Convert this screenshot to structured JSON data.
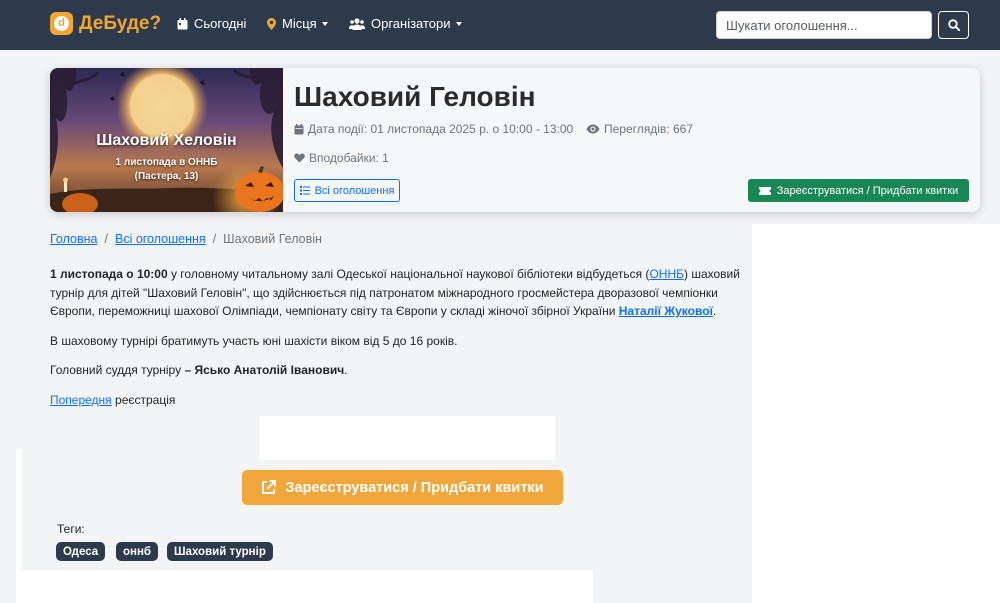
{
  "navbar": {
    "brand": "ДеБуде?",
    "brand_logo_letter": "d",
    "items": [
      {
        "label": "Сьогодні",
        "icon": "calendar-icon"
      },
      {
        "label": "Місця",
        "icon": "map-marker-icon"
      },
      {
        "label": "Організатори",
        "icon": "users-icon"
      }
    ],
    "search_placeholder": "Шукати оголошення..."
  },
  "event": {
    "title": "Шаховий Геловін",
    "poster": {
      "title": "Шаховий Хеловін",
      "line1": "1 листопада в ОННБ",
      "line2": "(Пастера, 13)"
    },
    "date": "Дата події: 01 листопада 2025 р. о 10:00 - 13:00",
    "views": "Переглядів: 667",
    "likes": "Вподобайки: 1",
    "all_label": "Всі оголошення",
    "register_label": "Зареєструватися / Придбати квитки"
  },
  "breadcrumb": {
    "home": "Головна",
    "all": "Всі оголошення",
    "current": "Шаховий Геловін"
  },
  "content": {
    "p1_bold": "1 листопада о 10:00",
    "p1_a": " у головному читальному залі Одеської національної наукової бібліотеки відбудеться (",
    "p1_link1": "ОННБ",
    "p1_b": ") шаховий",
    "p1_line2": "турнір для дітей \"Шаховий Геловін\", що здійснюється під патронатом міжнародного гросмейстера  дворазової чемпіонки",
    "p1_line3": "Європи, переможниці шахової Олімпіади, чемпіонату світу та Європи у складі жіночої збірної України ",
    "p1_link2": "Наталії Жукової",
    "p1_end": ".",
    "p2": "В шаховому турнірі братимуть участь юні шахісти віком від 5 до 16 років.",
    "p3_a": "Головний суддя турніру ",
    "p3_bold": "– Ясько Анатолій Іванович",
    "p3_end": ".",
    "p4_link": "Попередня",
    "p4_rest": " реєстрація"
  },
  "register_big_label": "Зареєструватися / Придбати квитки",
  "tags": {
    "label": "Теги:",
    "items": [
      "Одеса",
      "оннб",
      "Шаховий турнір"
    ]
  },
  "colors": {
    "navbar": "#2c3a4b",
    "brand": "#f0a632",
    "primary": "#0d6efd",
    "success": "#198754",
    "warning": "#f0a63a"
  }
}
